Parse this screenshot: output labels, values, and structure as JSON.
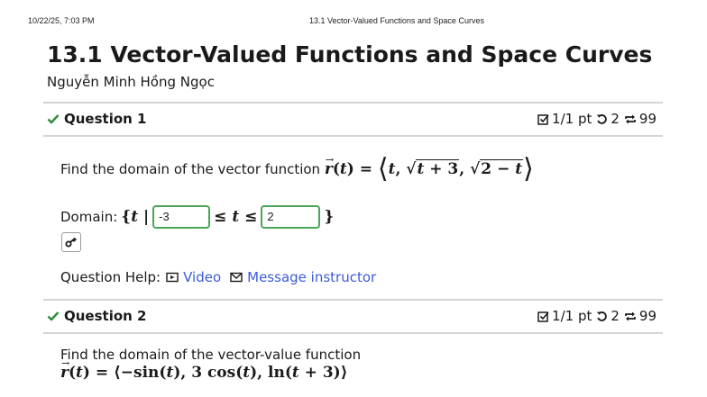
{
  "print_header": {
    "timestamp": "10/22/25, 7:03 PM",
    "doc_title": "13.1 Vector-Valued Functions and Space Curves"
  },
  "page": {
    "title": "13.1 Vector-Valued Functions and Space Curves",
    "student": "Nguyễn Minh Hồng Ngọc"
  },
  "questions": [
    {
      "label": "Question 1",
      "score": "1/1 pt",
      "retries": "2",
      "attempts": "99",
      "prompt": "Find the domain of the vector function",
      "domain_label": "Domain:",
      "answers": [
        "-3",
        "2"
      ],
      "help_label": "Question Help:",
      "video_label": "Video",
      "message_label": "Message instructor"
    },
    {
      "label": "Question 2",
      "score": "1/1 pt",
      "retries": "2",
      "attempts": "99",
      "prompt": "Find the domain of the vector-value function"
    }
  ],
  "colors": {
    "correct": "#2e8b3a",
    "link": "#3b5bdb",
    "answer_border": "#4aa55a"
  }
}
